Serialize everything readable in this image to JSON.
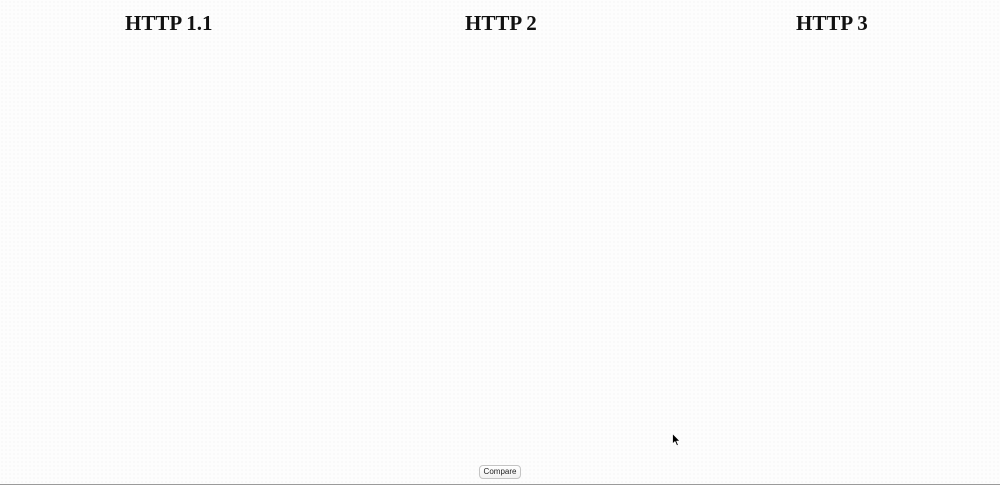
{
  "columns": [
    {
      "title": "HTTP 1.1"
    },
    {
      "title": "HTTP 2"
    },
    {
      "title": "HTTP 3"
    }
  ],
  "controls": {
    "compare_label": "Compare"
  },
  "icons": {
    "cursor": "mouse-pointer-icon"
  },
  "colors": {
    "background": "#fdfdfd",
    "title_text": "#111111",
    "button_border": "#c4c4c4"
  }
}
